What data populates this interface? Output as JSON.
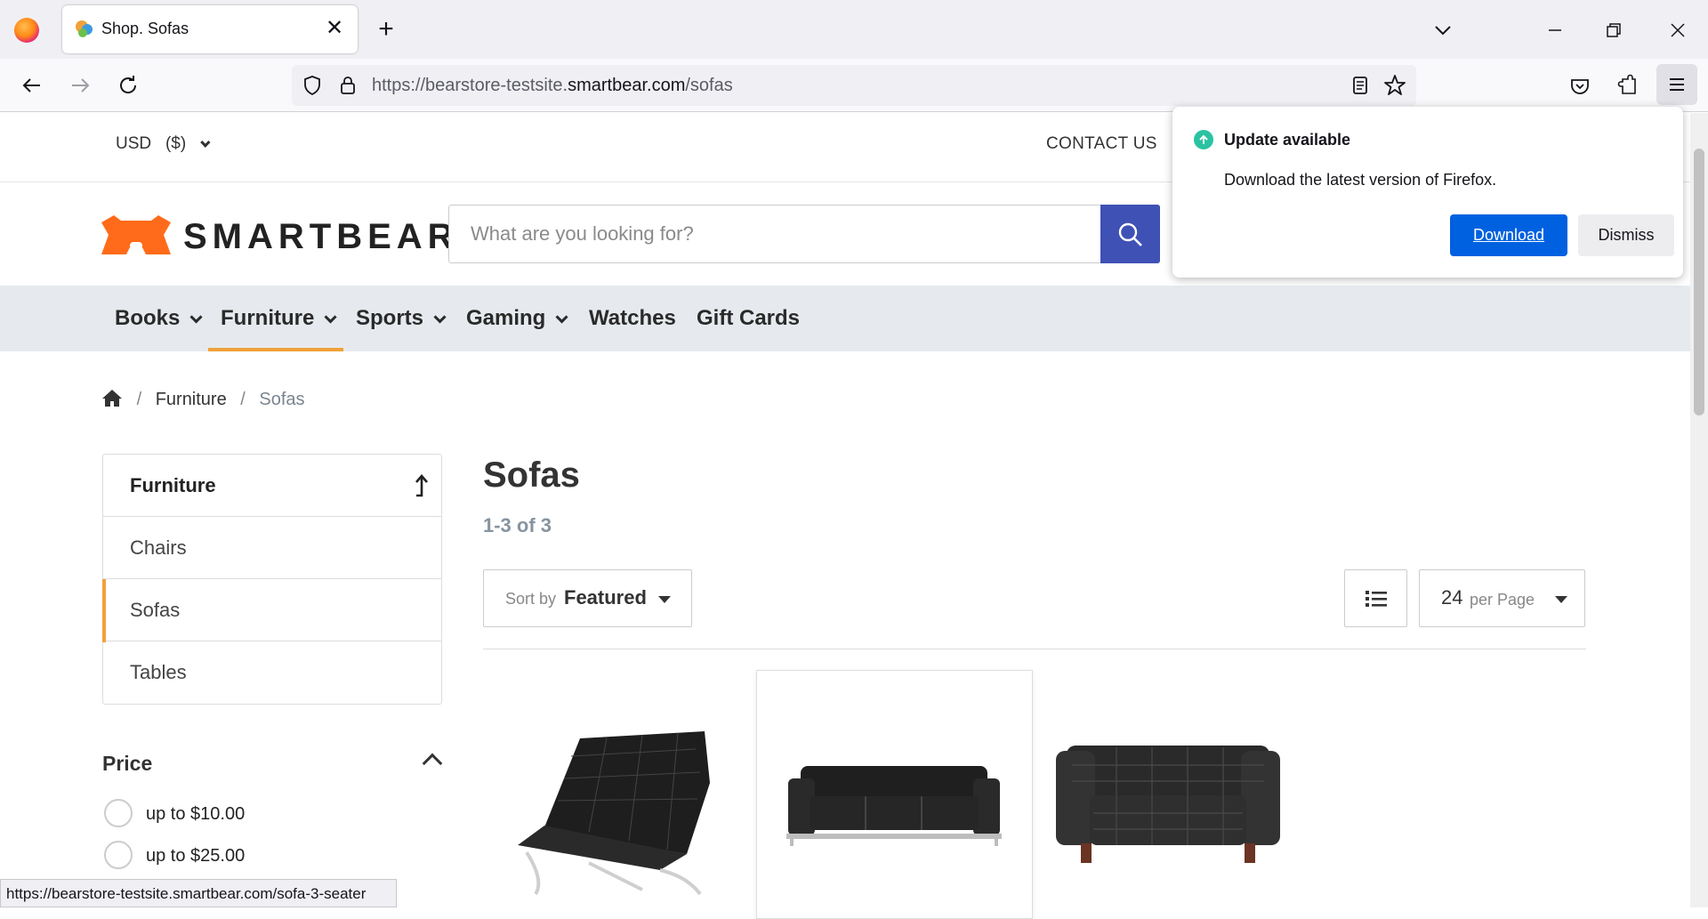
{
  "browser": {
    "tab_title": "Shop. Sofas",
    "url_prefix": "https://bearstore-testsite.",
    "url_domain": "smartbear.com",
    "url_path": "/sofas",
    "status_url": "https://bearstore-testsite.smartbear.com/sofa-3-seater"
  },
  "popup": {
    "title": "Update available",
    "message": "Download the latest version of Firefox.",
    "download_label": "Download",
    "dismiss_label": "Dismiss"
  },
  "header": {
    "currency": "USD",
    "currency_symbol": "($)",
    "contact": "CONTACT US",
    "logo_text": "SMARTBEAR",
    "search_placeholder": "What are you looking for?"
  },
  "categories": [
    {
      "label": "Books",
      "dropdown": true
    },
    {
      "label": "Furniture",
      "dropdown": true,
      "active": true
    },
    {
      "label": "Sports",
      "dropdown": true
    },
    {
      "label": "Gaming",
      "dropdown": true
    },
    {
      "label": "Watches",
      "dropdown": false
    },
    {
      "label": "Gift Cards",
      "dropdown": false
    }
  ],
  "breadcrumb": {
    "parent": "Furniture",
    "current": "Sofas"
  },
  "sidebar": {
    "heading": "Furniture",
    "items": [
      {
        "label": "Chairs"
      },
      {
        "label": "Sofas",
        "active": true
      },
      {
        "label": "Tables"
      }
    ]
  },
  "price_filter": {
    "title": "Price",
    "options": [
      "up to $10.00",
      "up to $25.00"
    ]
  },
  "main": {
    "title": "Sofas",
    "count": "1-3 of 3",
    "sort_prefix": "Sort by",
    "sort_value": "Featured",
    "per_page_value": "24",
    "per_page_label": "per Page"
  },
  "colors": {
    "accent": "#f0a13a",
    "search_button": "#3f51b5",
    "download_button": "#0061e0",
    "update_icon": "#2ac3a2"
  }
}
